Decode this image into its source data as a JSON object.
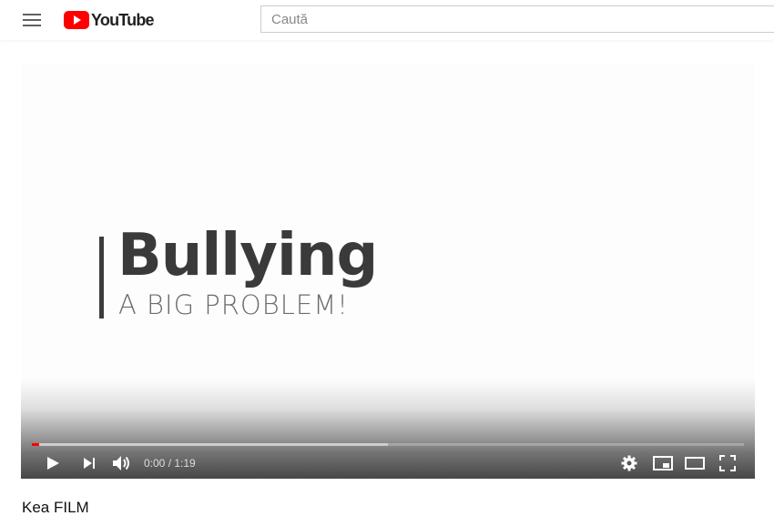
{
  "header": {
    "logo_text": "YouTube",
    "search_placeholder": "Caută"
  },
  "video": {
    "title_main": "Bullying",
    "title_sub": "A BIG PROBLEM!",
    "progress_played_fraction": 0.01,
    "progress_loaded_fraction": 0.5,
    "time_display": "0:00 / 1:19"
  },
  "channel": {
    "name": "Kea FILM"
  },
  "colors": {
    "brand_red": "#ff0000",
    "progress_red": "#ff0000"
  }
}
